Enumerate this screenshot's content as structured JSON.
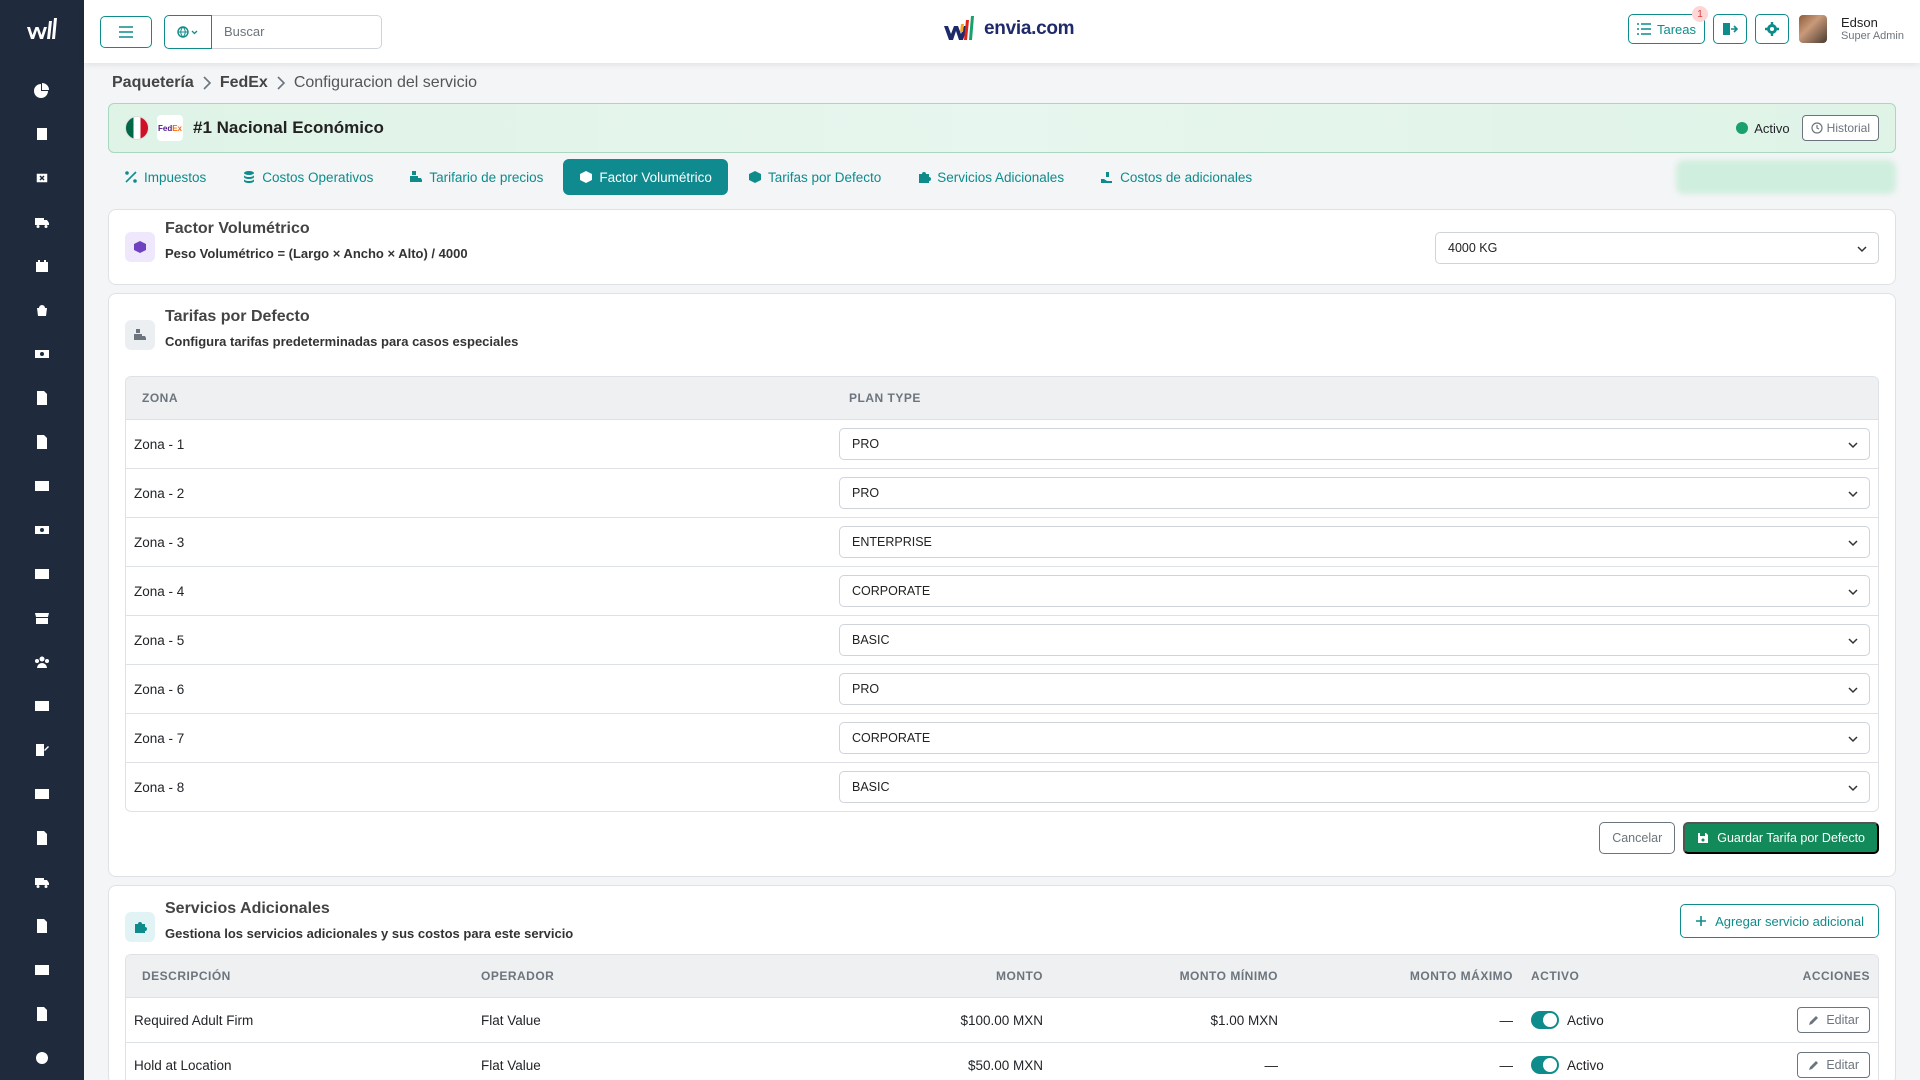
{
  "topbar": {
    "search_placeholder": "Buscar",
    "brand": "envia.com",
    "tareas_label": "Tareas",
    "tareas_count": "1",
    "user_name": "Edson",
    "user_role": "Super Admin"
  },
  "breadcrumb": {
    "item1": "Paquetería",
    "item2": "FedEx",
    "current": "Configuracion del servicio"
  },
  "service": {
    "carrier_logo": "FedEx",
    "title": "#1 Nacional Económico",
    "status": "Activo",
    "history_label": "Historial"
  },
  "tabs": [
    {
      "label": "Impuestos",
      "icon": "percent-icon"
    },
    {
      "label": "Costos Operativos",
      "icon": "coins-icon"
    },
    {
      "label": "Tarifario de precios",
      "icon": "truck-loading-icon"
    },
    {
      "label": "Factor Volumétrico",
      "icon": "box-icon"
    },
    {
      "label": "Tarifas por Defecto",
      "icon": "box-icon"
    },
    {
      "label": "Servicios Adicionales",
      "icon": "puzzle-icon"
    },
    {
      "label": "Costos de adicionales",
      "icon": "hand-holding-icon"
    }
  ],
  "factor": {
    "title": "Factor Volumétrico",
    "formula": "Peso Volumétrico = (Largo × Ancho × Alto) / 4000",
    "selected": "4000 KG"
  },
  "tarifas": {
    "title": "Tarifas por Defecto",
    "subtitle": "Configura tarifas predeterminadas para casos especiales",
    "col_zona": "ZONA",
    "col_plan": "PLAN TYPE",
    "rows": [
      {
        "zona": "Zona - 1",
        "plan": "PRO"
      },
      {
        "zona": "Zona - 2",
        "plan": "PRO"
      },
      {
        "zona": "Zona - 3",
        "plan": "ENTERPRISE"
      },
      {
        "zona": "Zona - 4",
        "plan": "CORPORATE"
      },
      {
        "zona": "Zona - 5",
        "plan": "BASIC"
      },
      {
        "zona": "Zona - 6",
        "plan": "PRO"
      },
      {
        "zona": "Zona - 7",
        "plan": "CORPORATE"
      },
      {
        "zona": "Zona - 8",
        "plan": "BASIC"
      }
    ],
    "cancel_label": "Cancelar",
    "save_label": "Guardar Tarifa por Defecto"
  },
  "servicios": {
    "title": "Servicios Adicionales",
    "subtitle": "Gestiona los servicios adicionales y sus costos para este servicio",
    "add_label": "Agregar servicio adicional",
    "columns": {
      "desc": "DESCRIPCIÓN",
      "op": "OPERADOR",
      "amt": "MONTO",
      "min": "MONTO MÍNIMO",
      "max": "MONTO MÁXIMO",
      "act": "ACTIVO",
      "acc": "ACCIONES"
    },
    "rows": [
      {
        "desc": "Required Adult Firm",
        "op": "Flat Value",
        "amt": "$100.00 MXN",
        "min": "$1.00 MXN",
        "max": "—",
        "active": "Activo",
        "edit": "Editar"
      },
      {
        "desc": "Hold at Location",
        "op": "Flat Value",
        "amt": "$50.00 MXN",
        "min": "—",
        "max": "—",
        "active": "Activo",
        "edit": "Editar"
      }
    ]
  },
  "colors": {
    "sidebar": "#1f2a3d",
    "accent": "#0e8c8c",
    "save": "#138a5a"
  }
}
